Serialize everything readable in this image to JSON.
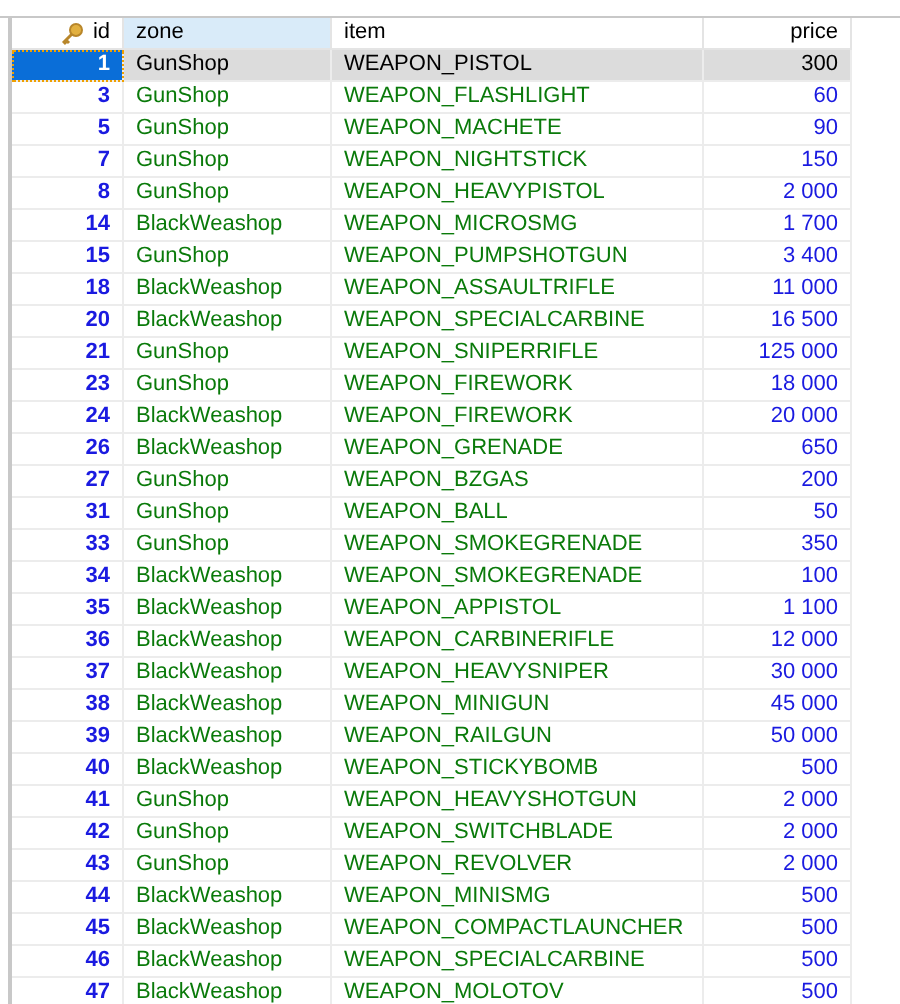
{
  "table": {
    "columns": [
      {
        "label": "id",
        "key": true,
        "selected": false
      },
      {
        "label": "zone",
        "key": false,
        "selected": true
      },
      {
        "label": "item",
        "key": false,
        "selected": false
      },
      {
        "label": "price",
        "key": false,
        "selected": false
      }
    ],
    "rows": [
      {
        "selected": true,
        "cells": [
          "1",
          "GunShop",
          "WEAPON_PISTOL",
          "300"
        ]
      },
      {
        "selected": false,
        "cells": [
          "3",
          "GunShop",
          "WEAPON_FLASHLIGHT",
          "60"
        ]
      },
      {
        "selected": false,
        "cells": [
          "5",
          "GunShop",
          "WEAPON_MACHETE",
          "90"
        ]
      },
      {
        "selected": false,
        "cells": [
          "7",
          "GunShop",
          "WEAPON_NIGHTSTICK",
          "150"
        ]
      },
      {
        "selected": false,
        "cells": [
          "8",
          "GunShop",
          "WEAPON_HEAVYPISTOL",
          "2 000"
        ]
      },
      {
        "selected": false,
        "cells": [
          "14",
          "BlackWeashop",
          "WEAPON_MICROSMG",
          "1 700"
        ]
      },
      {
        "selected": false,
        "cells": [
          "15",
          "GunShop",
          "WEAPON_PUMPSHOTGUN",
          "3 400"
        ]
      },
      {
        "selected": false,
        "cells": [
          "18",
          "BlackWeashop",
          "WEAPON_ASSAULTRIFLE",
          "11 000"
        ]
      },
      {
        "selected": false,
        "cells": [
          "20",
          "BlackWeashop",
          "WEAPON_SPECIALCARBINE",
          "16 500"
        ]
      },
      {
        "selected": false,
        "cells": [
          "21",
          "GunShop",
          "WEAPON_SNIPERRIFLE",
          "125 000"
        ]
      },
      {
        "selected": false,
        "cells": [
          "23",
          "GunShop",
          "WEAPON_FIREWORK",
          "18 000"
        ]
      },
      {
        "selected": false,
        "cells": [
          "24",
          "BlackWeashop",
          "WEAPON_FIREWORK",
          "20 000"
        ]
      },
      {
        "selected": false,
        "cells": [
          "26",
          "BlackWeashop",
          "WEAPON_GRENADE",
          "650"
        ]
      },
      {
        "selected": false,
        "cells": [
          "27",
          "GunShop",
          "WEAPON_BZGAS",
          "200"
        ]
      },
      {
        "selected": false,
        "cells": [
          "31",
          "GunShop",
          "WEAPON_BALL",
          "50"
        ]
      },
      {
        "selected": false,
        "cells": [
          "33",
          "GunShop",
          "WEAPON_SMOKEGRENADE",
          "350"
        ]
      },
      {
        "selected": false,
        "cells": [
          "34",
          "BlackWeashop",
          "WEAPON_SMOKEGRENADE",
          "100"
        ]
      },
      {
        "selected": false,
        "cells": [
          "35",
          "BlackWeashop",
          "WEAPON_APPISTOL",
          "1 100"
        ]
      },
      {
        "selected": false,
        "cells": [
          "36",
          "BlackWeashop",
          "WEAPON_CARBINERIFLE",
          "12 000"
        ]
      },
      {
        "selected": false,
        "cells": [
          "37",
          "BlackWeashop",
          "WEAPON_HEAVYSNIPER",
          "30 000"
        ]
      },
      {
        "selected": false,
        "cells": [
          "38",
          "BlackWeashop",
          "WEAPON_MINIGUN",
          "45 000"
        ]
      },
      {
        "selected": false,
        "cells": [
          "39",
          "BlackWeashop",
          "WEAPON_RAILGUN",
          "50 000"
        ]
      },
      {
        "selected": false,
        "cells": [
          "40",
          "BlackWeashop",
          "WEAPON_STICKYBOMB",
          "500"
        ]
      },
      {
        "selected": false,
        "cells": [
          "41",
          "GunShop",
          "WEAPON_HEAVYSHOTGUN",
          "2 000"
        ]
      },
      {
        "selected": false,
        "cells": [
          "42",
          "GunShop",
          "WEAPON_SWITCHBLADE",
          "2 000"
        ]
      },
      {
        "selected": false,
        "cells": [
          "43",
          "GunShop",
          "WEAPON_REVOLVER",
          "2 000"
        ]
      },
      {
        "selected": false,
        "cells": [
          "44",
          "BlackWeashop",
          "WEAPON_MINISMG",
          "500"
        ]
      },
      {
        "selected": false,
        "cells": [
          "45",
          "BlackWeashop",
          "WEAPON_COMPACTLAUNCHER",
          "500"
        ]
      },
      {
        "selected": false,
        "cells": [
          "46",
          "BlackWeashop",
          "WEAPON_SPECIALCARBINE",
          "500"
        ]
      },
      {
        "selected": false,
        "cells": [
          "47",
          "BlackWeashop",
          "WEAPON_MOLOTOV",
          "500"
        ]
      }
    ]
  }
}
